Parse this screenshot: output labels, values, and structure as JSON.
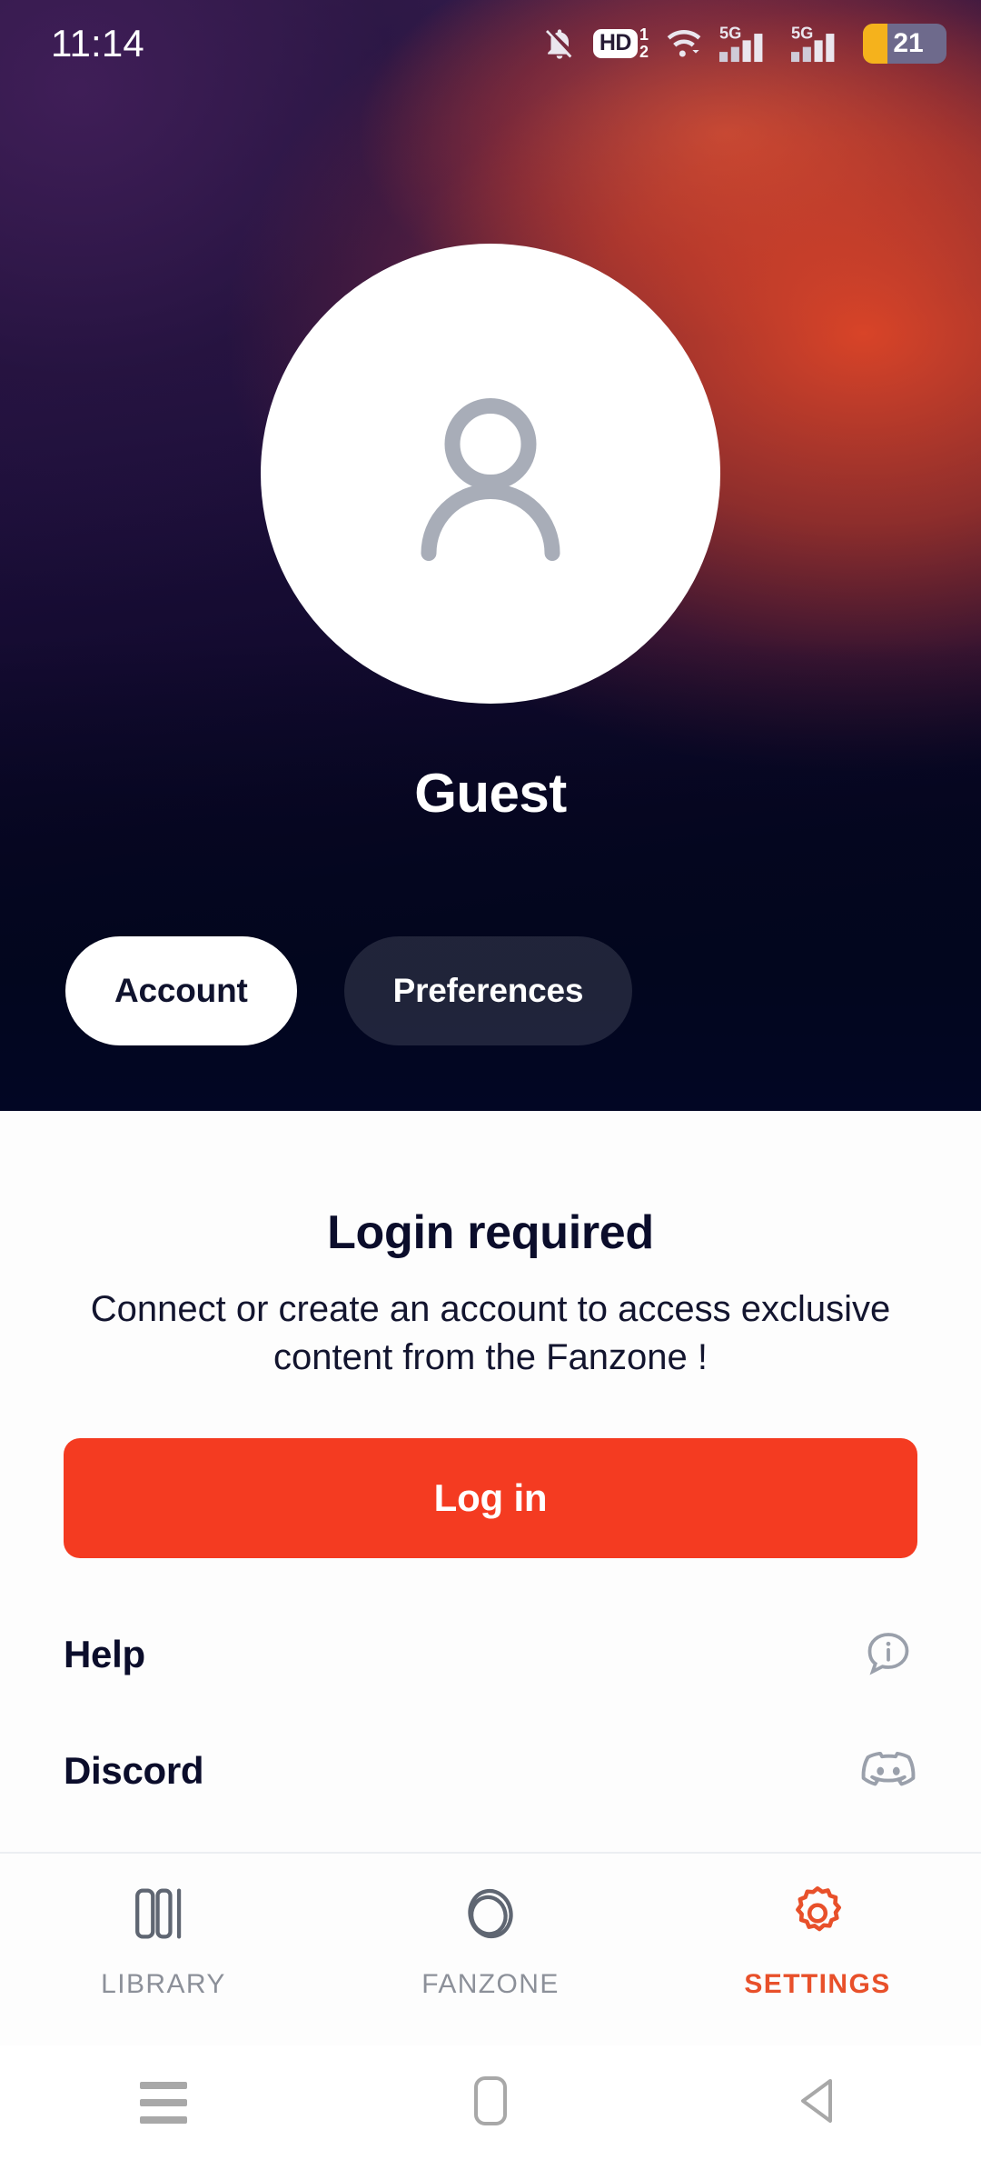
{
  "status_bar": {
    "time": "11:14",
    "icons": [
      "bell-off-icon",
      "hd-dual-sim-icon",
      "wifi-icon",
      "signal-5g-1-icon",
      "signal-5g-2-icon",
      "battery-icon"
    ],
    "hd_label": "HD",
    "sim_1": "1",
    "sim_2": "2",
    "network_1": "5G",
    "network_2": "5G",
    "battery_percent": "21"
  },
  "header": {
    "avatar_icon": "person-avatar-icon",
    "user_name": "Guest",
    "tabs": [
      {
        "label": "Account",
        "active": true
      },
      {
        "label": "Preferences",
        "active": false
      }
    ]
  },
  "main": {
    "title": "Login required",
    "subtitle": "Connect or create an account to access exclusive content from the Fanzone !",
    "login_button": "Log in",
    "rows": [
      {
        "label": "Help",
        "icon": "info-bubble-icon"
      },
      {
        "label": "Discord",
        "icon": "discord-icon"
      }
    ]
  },
  "bottom_nav": [
    {
      "label": "LIBRARY",
      "icon": "library-books-icon",
      "active": false
    },
    {
      "label": "FANZONE",
      "icon": "fanzone-ring-icon",
      "active": false
    },
    {
      "label": "SETTINGS",
      "icon": "gear-icon",
      "active": true
    }
  ],
  "android_nav": [
    {
      "name": "recents",
      "icon": "hamburger-icon"
    },
    {
      "name": "home",
      "icon": "home-square-icon"
    },
    {
      "name": "back",
      "icon": "back-triangle-icon"
    }
  ],
  "colors": {
    "accent_red": "#f43b21",
    "active_tab_red": "#e8502a",
    "header_dark": "#02051c",
    "text_dark": "#0b0d2b",
    "battery_fill": "#f5b21c"
  }
}
